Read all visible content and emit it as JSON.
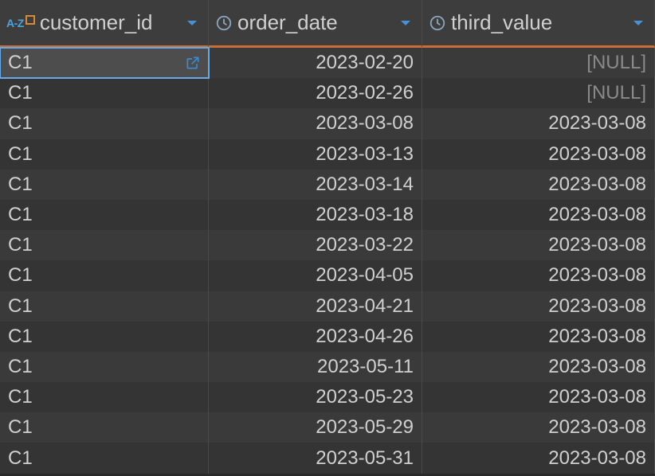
{
  "columns": [
    {
      "name": "customer_id",
      "type_label": "A-Z",
      "has_key": true,
      "type": "text"
    },
    {
      "name": "order_date",
      "type": "time"
    },
    {
      "name": "third_value",
      "type": "time"
    }
  ],
  "null_display": "[NULL]",
  "rows": [
    {
      "customer_id": "C1",
      "order_date": "2023-02-20",
      "third_value": null
    },
    {
      "customer_id": "C1",
      "order_date": "2023-02-26",
      "third_value": null
    },
    {
      "customer_id": "C1",
      "order_date": "2023-03-08",
      "third_value": "2023-03-08"
    },
    {
      "customer_id": "C1",
      "order_date": "2023-03-13",
      "third_value": "2023-03-08"
    },
    {
      "customer_id": "C1",
      "order_date": "2023-03-14",
      "third_value": "2023-03-08"
    },
    {
      "customer_id": "C1",
      "order_date": "2023-03-18",
      "third_value": "2023-03-08"
    },
    {
      "customer_id": "C1",
      "order_date": "2023-03-22",
      "third_value": "2023-03-08"
    },
    {
      "customer_id": "C1",
      "order_date": "2023-04-05",
      "third_value": "2023-03-08"
    },
    {
      "customer_id": "C1",
      "order_date": "2023-04-21",
      "third_value": "2023-03-08"
    },
    {
      "customer_id": "C1",
      "order_date": "2023-04-26",
      "third_value": "2023-03-08"
    },
    {
      "customer_id": "C1",
      "order_date": "2023-05-11",
      "third_value": "2023-03-08"
    },
    {
      "customer_id": "C1",
      "order_date": "2023-05-23",
      "third_value": "2023-03-08"
    },
    {
      "customer_id": "C1",
      "order_date": "2023-05-29",
      "third_value": "2023-03-08"
    },
    {
      "customer_id": "C1",
      "order_date": "2023-05-31",
      "third_value": "2023-03-08"
    }
  ],
  "selected": {
    "row": 0,
    "col": 0
  },
  "icons": {
    "clock": "clock-icon",
    "dropdown": "chevron-down-icon",
    "external": "external-link-icon"
  }
}
